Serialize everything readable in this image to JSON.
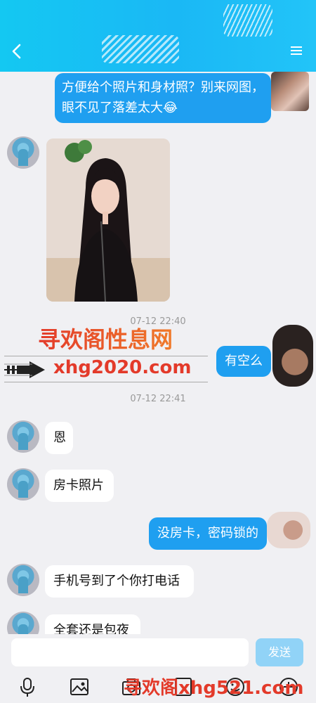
{
  "chat": {
    "messages": [
      {
        "side": "right",
        "text": "方便给个照片和身材照？别来网图，眼不见了落差太大😂"
      },
      {
        "side": "left",
        "type": "image"
      },
      {
        "type": "time",
        "text": "07-12 22:40"
      },
      {
        "side": "right",
        "text": "有空么"
      },
      {
        "type": "time",
        "text": "07-12 22:41"
      },
      {
        "side": "left",
        "text": "恩"
      },
      {
        "side": "left",
        "text": "房卡照片"
      },
      {
        "side": "right",
        "text": "没房卡，密码锁的"
      },
      {
        "side": "left",
        "text": "手机号到了个你打电话"
      },
      {
        "side": "left",
        "text": "全套还是包夜"
      }
    ]
  },
  "watermark": {
    "line1": "寻欢阁性息网",
    "line2": "xhg2020.com",
    "bottom": "寻欢阁xhg521.com"
  },
  "input": {
    "send_label": "发送"
  },
  "colors": {
    "header": "#1ab8f5",
    "bubble_right": "#1f9ff0",
    "send_disabled": "#91d3f7",
    "watermark": "#e33a2a"
  }
}
